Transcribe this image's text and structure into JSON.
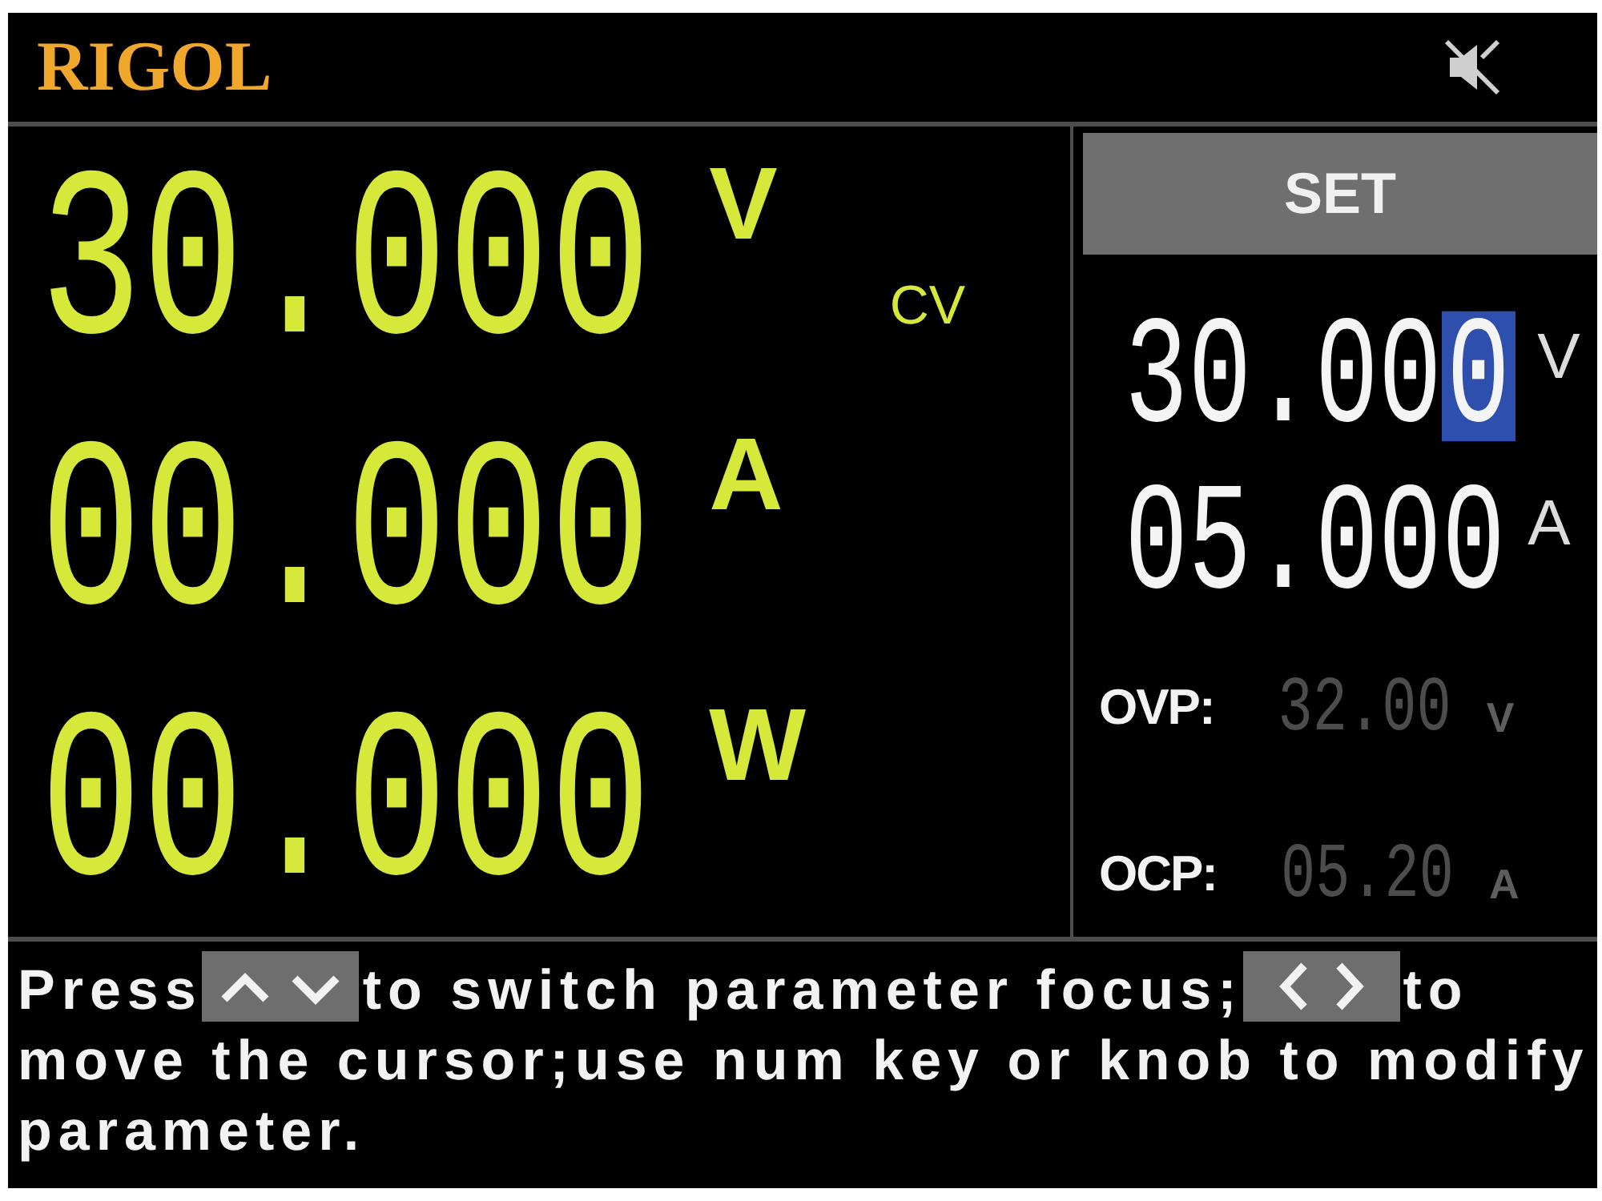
{
  "header": {
    "logo": "RIGOL",
    "muted": true
  },
  "readings": [
    {
      "value": "30.000",
      "unit": "V"
    },
    {
      "value": "00.000",
      "unit": "A"
    },
    {
      "value": "00.000",
      "unit": "W"
    }
  ],
  "mode": "CV",
  "set_panel": {
    "title": "SET",
    "settings": [
      {
        "value": "30.00",
        "cursor": "0",
        "unit": "V"
      },
      {
        "value": "05.000",
        "unit": "A"
      }
    ],
    "protections": [
      {
        "label": "OVP:",
        "value": "32.00",
        "unit": "V",
        "enabled": false
      },
      {
        "label": "OCP:",
        "value": "05.20",
        "unit": "A",
        "enabled": false
      }
    ]
  },
  "help": [
    {
      "kind": "text",
      "text": "Press"
    },
    {
      "kind": "updown-keys"
    },
    {
      "kind": "text",
      "text": "to switch parameter focus;"
    },
    {
      "kind": "leftright-keys"
    },
    {
      "kind": "text",
      "text": "to move the cursor;use num key or knob to modify parameter."
    }
  ]
}
